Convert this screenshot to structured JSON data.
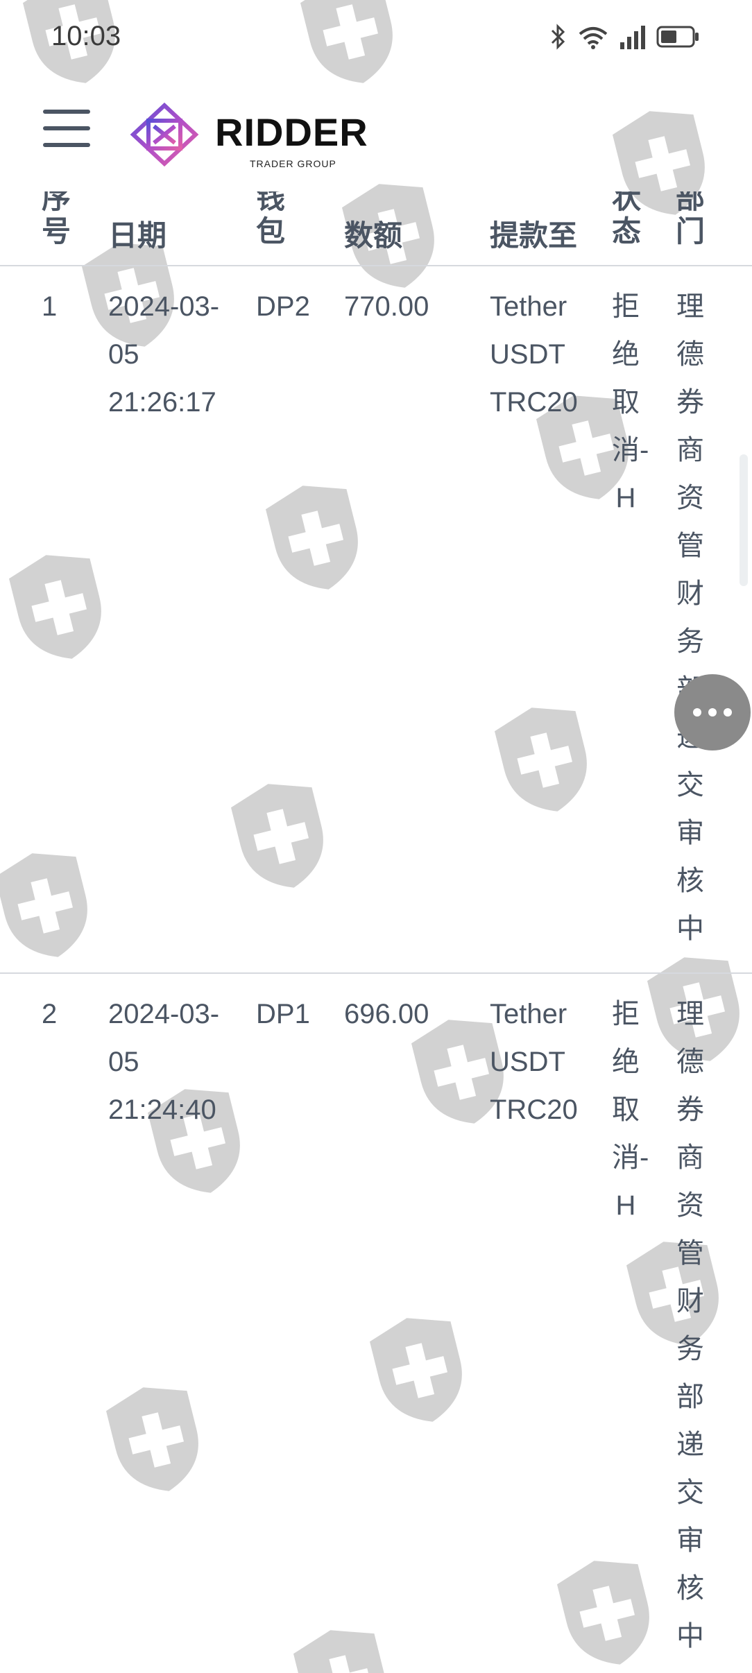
{
  "status_bar": {
    "time": "10:03"
  },
  "brand": {
    "name": "RIDDER",
    "tagline": "TRADER GROUP"
  },
  "table": {
    "headers": {
      "index": "序号",
      "date": "日期",
      "wallet": "钱包",
      "amount": "数额",
      "withdraw_to": "提款至",
      "status": "状态",
      "department": "部门"
    },
    "rows": [
      {
        "index": "1",
        "date": "2024-03-05 21:26:17",
        "wallet": "DP2",
        "amount": "770.00",
        "withdraw_to": "Tether USDT TRC20",
        "status": "拒绝取消-H",
        "department": "理德券商资管财务部递交审核中"
      },
      {
        "index": "2",
        "date": "2024-03-05 21:24:40",
        "wallet": "DP1",
        "amount": "696.00",
        "withdraw_to": "Tether USDT TRC20",
        "status": "拒绝取消-H",
        "department": "理德券商资管财务部递交审核中"
      }
    ]
  },
  "icons": {
    "menu": "hamburger-menu-icon",
    "watermark": "shield-cross-icon",
    "floating": "more-horizontal-icon"
  },
  "colors": {
    "text": "#4b5563",
    "border": "#d6d9de",
    "watermark": "#d0d0d0",
    "float_button": "#8a8a8a"
  }
}
